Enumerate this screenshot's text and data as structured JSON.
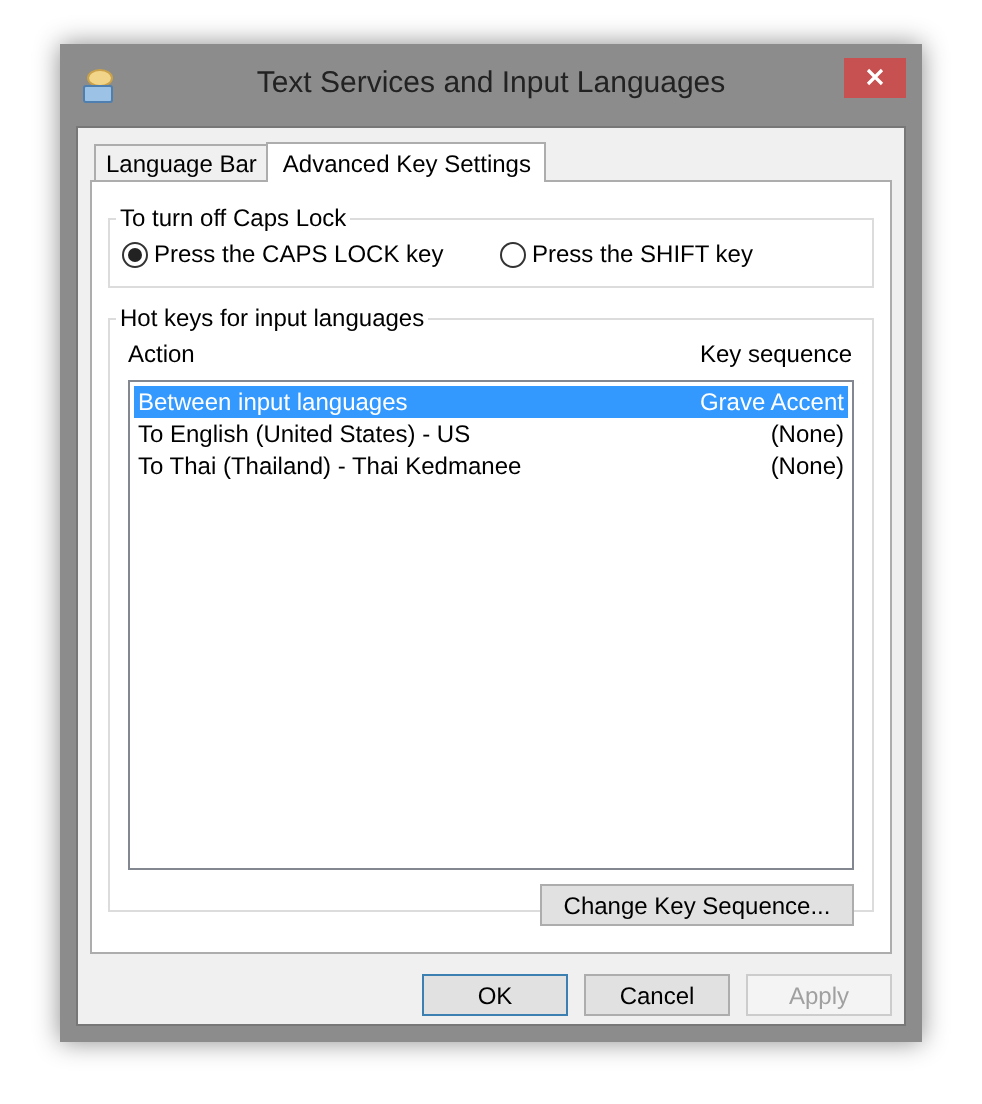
{
  "window": {
    "title": "Text Services and Input Languages"
  },
  "tabs": [
    {
      "label": "Language Bar",
      "selected": false
    },
    {
      "label": "Advanced Key Settings",
      "selected": true
    }
  ],
  "caps_lock": {
    "title": "To turn off Caps Lock",
    "options": [
      {
        "label": "Press the CAPS LOCK key",
        "selected": true
      },
      {
        "label": "Press the SHIFT key",
        "selected": false
      }
    ]
  },
  "hot_keys": {
    "title": "Hot keys for input languages",
    "columns": [
      "Action",
      "Key sequence"
    ],
    "rows": [
      {
        "action": "Between input languages",
        "key_sequence": "Grave Accent",
        "selected": true
      },
      {
        "action": "To English (United States) - US",
        "key_sequence": "(None)",
        "selected": false
      },
      {
        "action": "To Thai (Thailand) - Thai Kedmanee",
        "key_sequence": "(None)",
        "selected": false
      }
    ],
    "button": "Change Key Sequence..."
  },
  "buttons": [
    {
      "label": "OK",
      "disabled": false,
      "default": true
    },
    {
      "label": "Cancel",
      "disabled": false,
      "default": false
    },
    {
      "label": "Apply",
      "disabled": true,
      "default": false
    }
  ]
}
